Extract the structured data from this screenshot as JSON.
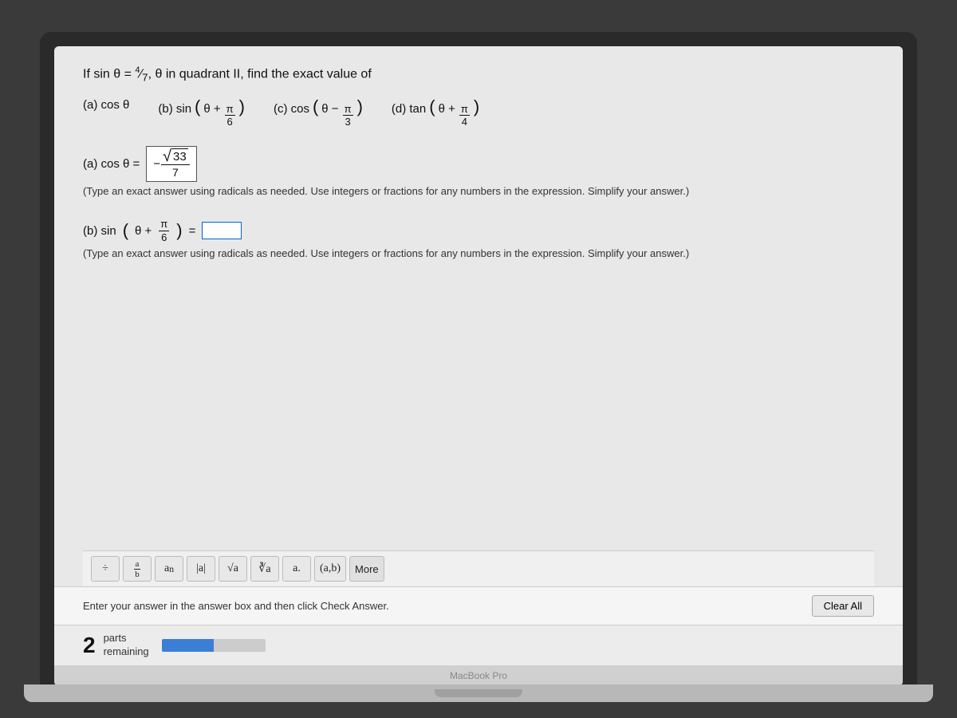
{
  "screen": {
    "question": {
      "prefix": "If sin θ =",
      "fraction": {
        "num": "4",
        "den": "7"
      },
      "suffix": ", θ in quadrant II, find the exact value of"
    },
    "choices": [
      {
        "id": "a",
        "func": "cos",
        "arg": "θ"
      },
      {
        "id": "b",
        "func": "sin",
        "arg": "θ",
        "addFrac": {
          "num": "π",
          "den": "6"
        }
      },
      {
        "id": "c",
        "func": "cos",
        "arg": "θ",
        "subFrac": {
          "num": "π",
          "den": "3"
        }
      },
      {
        "id": "d",
        "func": "tan",
        "arg": "θ",
        "addFrac": {
          "num": "π",
          "den": "4"
        }
      }
    ],
    "answer_a": {
      "label": "(a) cos θ =",
      "value_neg": "-",
      "value_sqrt": "33",
      "value_den": "7"
    },
    "instruction_a": "(Type an exact answer using radicals as needed. Use integers or fractions for any numbers in the expression. Simplify your answer.)",
    "answer_b": {
      "label": "(b) sin",
      "arg": "θ +",
      "frac_num": "π",
      "frac_den": "6",
      "equals": "="
    },
    "instruction_b": "(Type an exact answer using radicals as needed. Use integers or fractions for any numbers in the expression. Simplify your answer.)",
    "toolbar": {
      "buttons": [
        "÷",
        "a/b",
        "aⁿ",
        "|a|",
        "√a",
        "∛a",
        "a.",
        "(a,b)",
        "More"
      ]
    },
    "bottom": {
      "instruction": "Enter your answer in the answer box and then click Check Answer.",
      "clear_all": "Clear All"
    },
    "parts": {
      "count": "2",
      "label_line1": "parts",
      "label_line2": "remaining"
    },
    "macbook_label": "MacBook Pro"
  }
}
